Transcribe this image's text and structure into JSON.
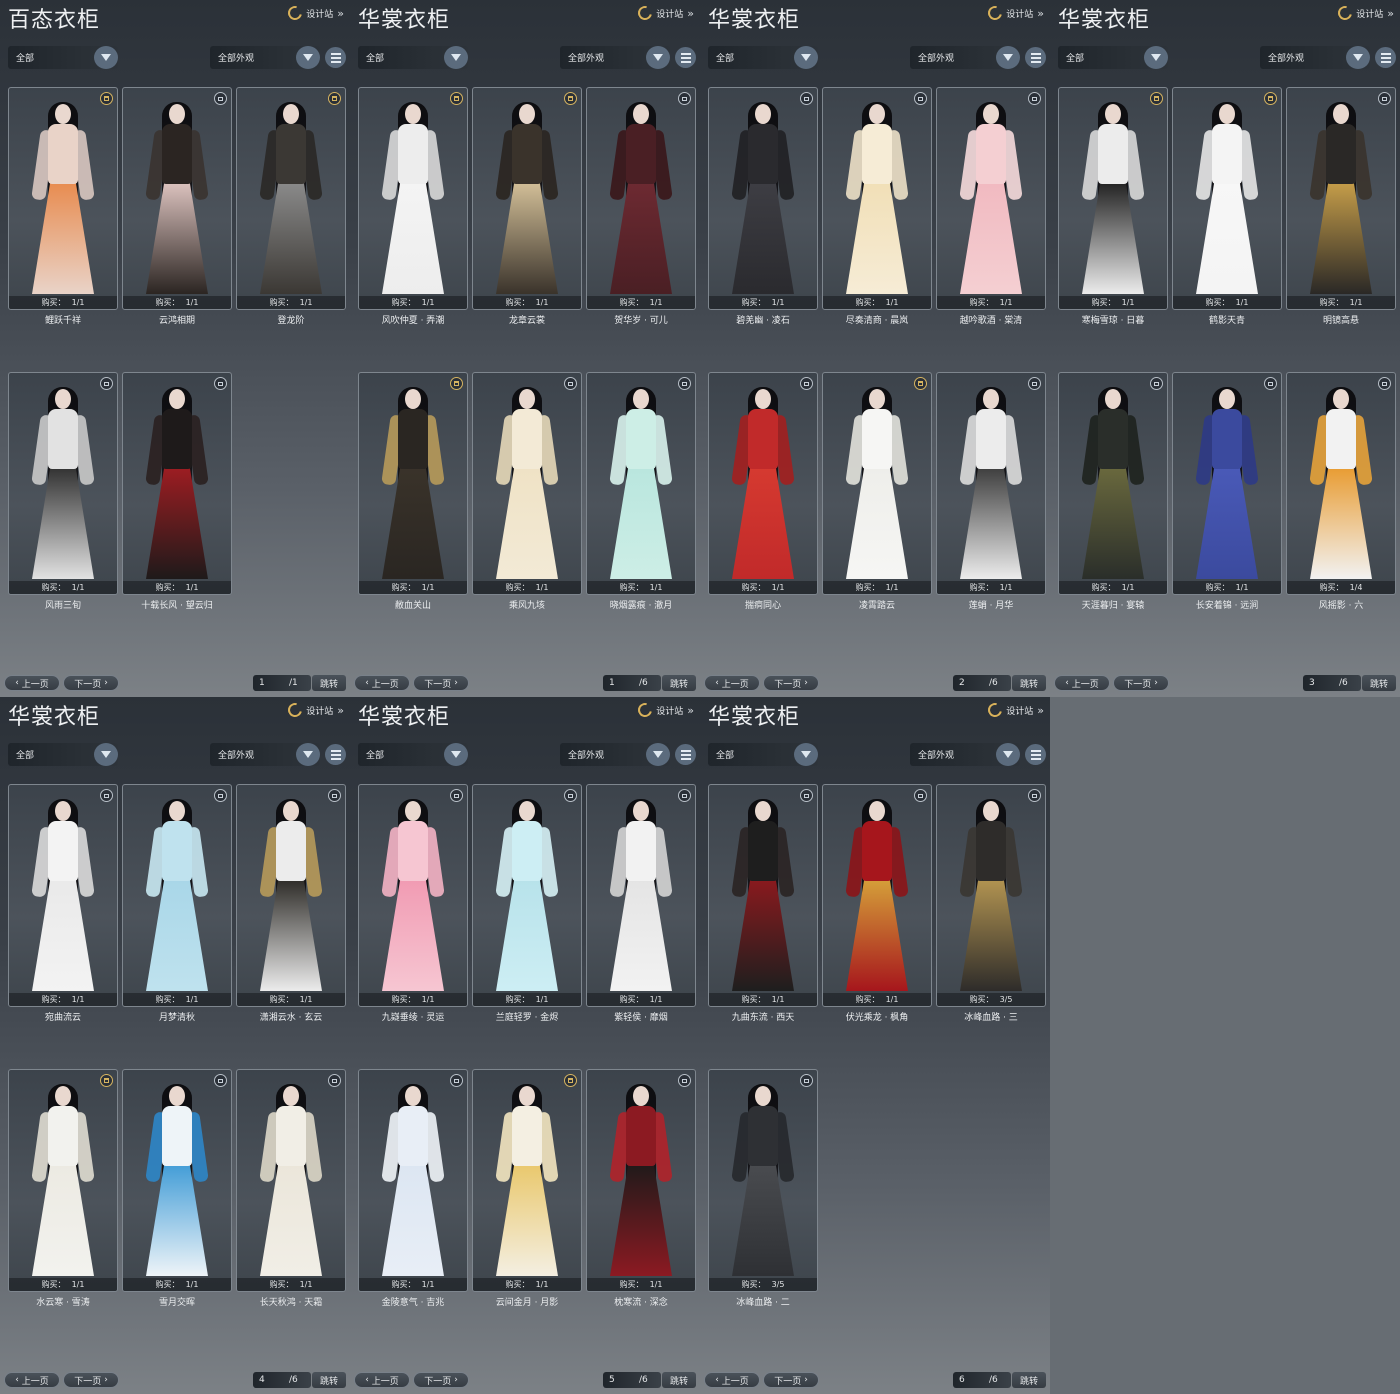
{
  "panels": [
    {
      "title": "百态衣柜",
      "design_link": "设计站",
      "filter_category": "全部",
      "filter_appearance": "全部外观",
      "cards": [
        {
          "name": "鲤跃千祥",
          "buy": "购买：",
          "count": "1/1",
          "icon": "trash-icon",
          "palette": [
            "#e9d3c8",
            "#e88a4d",
            "#d8c7c0"
          ]
        },
        {
          "name": "云鸿相期",
          "buy": "购买：",
          "count": "1/1",
          "icon": "tag-icon",
          "palette": [
            "#2b2522",
            "#e0c6c2",
            "#3a3330"
          ]
        },
        {
          "name": "登龙阶",
          "buy": "购买：",
          "count": "1/1",
          "icon": "trash-icon",
          "palette": [
            "#3b3834",
            "#8c8c8c",
            "#2a2826"
          ]
        },
        {
          "name": "风雨三旬",
          "buy": "购买：",
          "count": "1/1",
          "icon": "tag-icon",
          "palette": [
            "#e2e2e2",
            "#2e2e2e",
            "#c9c9c9"
          ]
        },
        {
          "name": "十载长风 · 望云归",
          "buy": "购买：",
          "count": "1/1",
          "icon": "tag-icon",
          "palette": [
            "#1e1a1a",
            "#a01d22",
            "#2a2020"
          ]
        }
      ],
      "prev": "上一页",
      "next": "下一页",
      "page": "1",
      "total": "/1",
      "jump": "跳转"
    },
    {
      "title": "华裳衣柜",
      "design_link": "设计站",
      "filter_category": "全部",
      "filter_appearance": "全部外观",
      "cards": [
        {
          "name": "风吹仲夏 · 弄潮",
          "buy": "购买：",
          "count": "1/1",
          "icon": "trash-icon",
          "palette": [
            "#ededed",
            "#f4f4f4",
            "#d8d8d8"
          ]
        },
        {
          "name": "龙章云裳",
          "buy": "购买：",
          "count": "1/1",
          "icon": "trash-icon",
          "palette": [
            "#3a332b",
            "#d6c29a",
            "#2a2520"
          ]
        },
        {
          "name": "贺华岁 · 可儿",
          "buy": "购买：",
          "count": "1/1",
          "icon": "tag-icon",
          "palette": [
            "#4a1f24",
            "#6e2a32",
            "#3a161a"
          ]
        },
        {
          "name": "敝血关山",
          "buy": "购买：",
          "count": "1/1",
          "icon": "trash-icon",
          "palette": [
            "#2a2622",
            "#3a332a",
            "#b79a5a"
          ]
        },
        {
          "name": "乘风九垓",
          "buy": "购买：",
          "count": "1/1",
          "icon": "tag-icon",
          "palette": [
            "#f3ead6",
            "#efe2c5",
            "#e6d8b8"
          ]
        },
        {
          "name": "晓烟露痕 · 澈月",
          "buy": "购买：",
          "count": "1/1",
          "icon": "tag-icon",
          "palette": [
            "#cdeee6",
            "#b9e6de",
            "#d8f2ec"
          ]
        }
      ],
      "prev": "上一页",
      "next": "下一页",
      "page": "1",
      "total": "/6",
      "jump": "跳转"
    },
    {
      "title": "华裳衣柜",
      "design_link": "设计站",
      "filter_category": "全部",
      "filter_appearance": "全部外观",
      "cards": [
        {
          "name": "碧羌幽 · 凌石",
          "buy": "购买：",
          "count": "1/1",
          "icon": "tag-icon",
          "palette": [
            "#2a2a2e",
            "#3e3e44",
            "#202024"
          ]
        },
        {
          "name": "尽奏清商 · 晨岚",
          "buy": "购买：",
          "count": "1/1",
          "icon": "tag-icon",
          "palette": [
            "#f6ecd6",
            "#f1dfb6",
            "#ece0c6"
          ]
        },
        {
          "name": "越吟歌酒 · 棠清",
          "buy": "购买：",
          "count": "1/1",
          "icon": "tag-icon",
          "palette": [
            "#f4cfd2",
            "#f1b9c0",
            "#f6dadb"
          ]
        },
        {
          "name": "揣痌同心",
          "buy": "购买：",
          "count": "1/1",
          "icon": "tag-icon",
          "palette": [
            "#c12a2a",
            "#d63a30",
            "#a31f1f"
          ]
        },
        {
          "name": "凌霄踏云",
          "buy": "购买：",
          "count": "1/1",
          "icon": "trash-icon",
          "palette": [
            "#f6f6f4",
            "#eeeeea",
            "#e2e2dc"
          ]
        },
        {
          "name": "莲蛸 · 月华",
          "buy": "购买：",
          "count": "1/1",
          "icon": "tag-icon",
          "palette": [
            "#ececec",
            "#3a3a3a",
            "#dcdcdc"
          ]
        }
      ],
      "prev": "上一页",
      "next": "下一页",
      "page": "2",
      "total": "/6",
      "jump": "跳转"
    },
    {
      "title": "华裳衣柜",
      "design_link": "设计站",
      "filter_category": "全部",
      "filter_appearance": "全部外观",
      "cards": [
        {
          "name": "寒梅雪琼 · 日暮",
          "buy": "购买：",
          "count": "1/1",
          "icon": "trash-icon",
          "palette": [
            "#ececec",
            "#1e1e1e",
            "#d8d8d8"
          ]
        },
        {
          "name": "鹤影天青",
          "buy": "购买：",
          "count": "1/1",
          "icon": "trash-icon",
          "palette": [
            "#f4f4f4",
            "#f7f7f7",
            "#e6e6e6"
          ]
        },
        {
          "name": "明镜高悬",
          "buy": "购买：",
          "count": "1/1",
          "icon": "tag-icon",
          "palette": [
            "#2a2826",
            "#c9a04a",
            "#3a332c"
          ]
        },
        {
          "name": "天涯暮归 · 宴辕",
          "buy": "购买：",
          "count": "1/1",
          "icon": "tag-icon",
          "palette": [
            "#2a2e2a",
            "#6b6a3e",
            "#1e221e"
          ]
        },
        {
          "name": "长安着锦 · 远涧",
          "buy": "购买：",
          "count": "1/1",
          "icon": "tag-icon",
          "palette": [
            "#3b4a9e",
            "#4a5ab8",
            "#2e3a86"
          ]
        },
        {
          "name": "风摇影 · 六",
          "buy": "购买：",
          "count": "1/4",
          "icon": "tag-icon",
          "palette": [
            "#f2f2f2",
            "#e89a2e",
            "#e6a23a"
          ]
        }
      ],
      "prev": "上一页",
      "next": "下一页",
      "page": "3",
      "total": "/6",
      "jump": "跳转"
    },
    {
      "title": "华裳衣柜",
      "design_link": "设计站",
      "filter_category": "全部",
      "filter_appearance": "全部外观",
      "cards": [
        {
          "name": "宛曲流云",
          "buy": "购买：",
          "count": "1/1",
          "icon": "tag-icon",
          "palette": [
            "#f3f3f3",
            "#e9e9e9",
            "#dadada"
          ]
        },
        {
          "name": "月梦清秋",
          "buy": "购买：",
          "count": "1/1",
          "icon": "tag-icon",
          "palette": [
            "#bfe2ee",
            "#a8d6e8",
            "#c8e8f2"
          ]
        },
        {
          "name": "潇湘云水 · 玄云",
          "buy": "购买：",
          "count": "1/1",
          "icon": "tag-icon",
          "palette": [
            "#ececec",
            "#2a2824",
            "#b79a5a"
          ]
        },
        {
          "name": "水云寒 · 雪涛",
          "buy": "购买：",
          "count": "1/1",
          "icon": "trash-icon",
          "palette": [
            "#f2f2ee",
            "#eceae2",
            "#e0ddd2"
          ]
        },
        {
          "name": "雪月交晖",
          "buy": "购买：",
          "count": "1/1",
          "icon": "tag-icon",
          "palette": [
            "#eef4f8",
            "#3f9bd6",
            "#2e86c8"
          ]
        },
        {
          "name": "长天秋鸿 · 天霜",
          "buy": "购买：",
          "count": "1/1",
          "icon": "tag-icon",
          "palette": [
            "#f1eee6",
            "#ebe6da",
            "#ddd7c8"
          ]
        }
      ],
      "prev": "上一页",
      "next": "下一页",
      "page": "4",
      "total": "/6",
      "jump": "跳转"
    },
    {
      "title": "华裳衣柜",
      "design_link": "设计站",
      "filter_category": "全部",
      "filter_appearance": "全部外观",
      "cards": [
        {
          "name": "九嶷垂绫 · 灵运",
          "buy": "购买：",
          "count": "1/1",
          "icon": "tag-icon",
          "palette": [
            "#f6c6d2",
            "#f19ab2",
            "#f4b2c4"
          ]
        },
        {
          "name": "兰庭轻罗 · 金烬",
          "buy": "购买：",
          "count": "1/1",
          "icon": "tag-icon",
          "palette": [
            "#cdeef4",
            "#b7e2ea",
            "#d6f1f5"
          ]
        },
        {
          "name": "紫轻侯 · 靡烟",
          "buy": "购买：",
          "count": "1/1",
          "icon": "tag-icon",
          "palette": [
            "#f2f2f2",
            "#e4e4e4",
            "#d4d4d4"
          ]
        },
        {
          "name": "金陵意气 · 吉兆",
          "buy": "购买：",
          "count": "1/1",
          "icon": "tag-icon",
          "palette": [
            "#e8eef6",
            "#dce6f2",
            "#f0f4f8"
          ]
        },
        {
          "name": "云间金月 · 月影",
          "buy": "购买：",
          "count": "1/1",
          "icon": "trash-icon",
          "palette": [
            "#f4efe2",
            "#e9c76a",
            "#f3e6c0"
          ]
        },
        {
          "name": "枕寒流 · 深念",
          "buy": "购买：",
          "count": "1/1",
          "icon": "tag-icon",
          "palette": [
            "#8c1a22",
            "#1e1a1a",
            "#b0222a"
          ]
        }
      ],
      "prev": "上一页",
      "next": "下一页",
      "page": "5",
      "total": "/6",
      "jump": "跳转"
    },
    {
      "title": "华裳衣柜",
      "design_link": "设计站",
      "filter_category": "全部",
      "filter_appearance": "全部外观",
      "cards": [
        {
          "name": "九曲东流 · 西天",
          "buy": "购买：",
          "count": "1/1",
          "icon": "tag-icon",
          "palette": [
            "#1e1e1e",
            "#8c1a1e",
            "#2a2424"
          ]
        },
        {
          "name": "伏光乘龙 · 枫角",
          "buy": "购买：",
          "count": "1/1",
          "icon": "tag-icon",
          "palette": [
            "#a6161c",
            "#d6a23a",
            "#8c1418"
          ]
        },
        {
          "name": "冰峰血路 · 三",
          "buy": "购买：",
          "count": "3/5",
          "icon": "tag-icon",
          "palette": [
            "#2e2c2a",
            "#b59652",
            "#3a3632"
          ]
        },
        {
          "name": "冰峰血路 · 二",
          "buy": "购买：",
          "count": "3/5",
          "icon": "tag-icon",
          "palette": [
            "#2e3034",
            "#4a4c50",
            "#26282c"
          ]
        }
      ],
      "prev": "上一页",
      "next": "下一页",
      "page": "6",
      "total": "/6",
      "jump": "跳转"
    }
  ]
}
